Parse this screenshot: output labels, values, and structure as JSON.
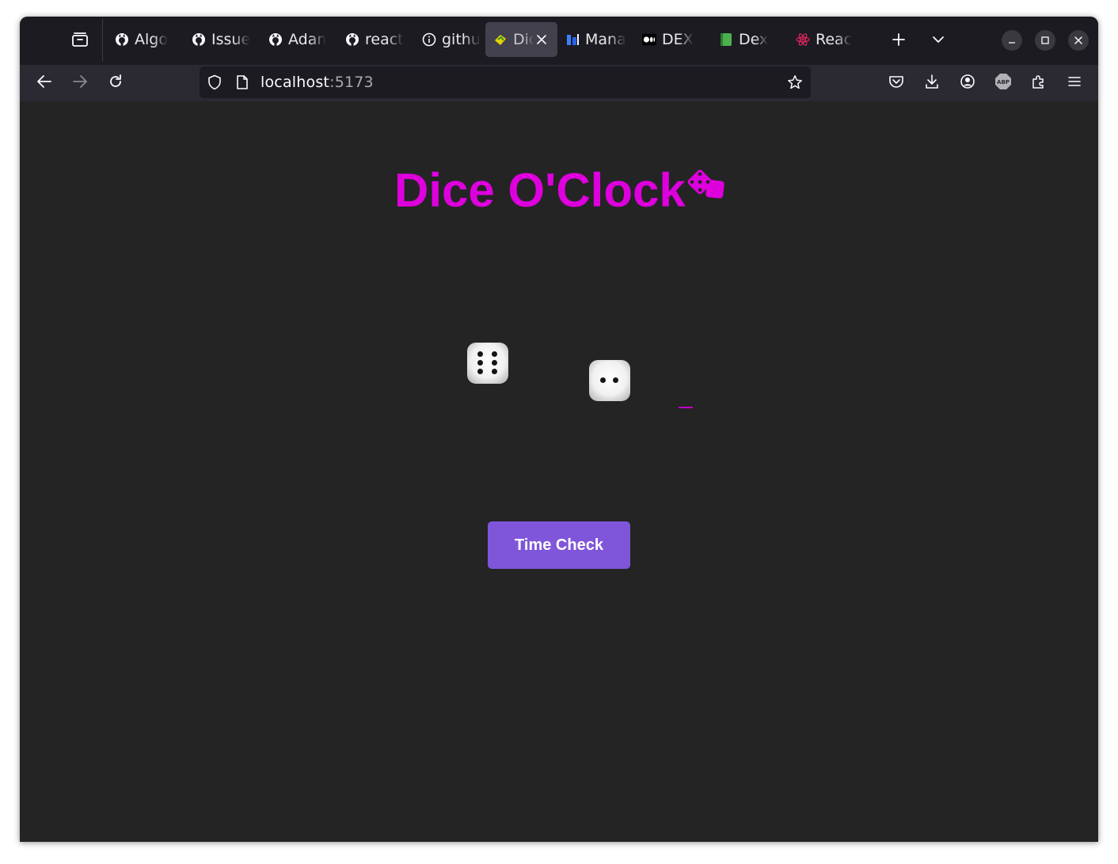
{
  "browser": {
    "tabs": [
      {
        "label": "Algo",
        "favicon": "github-icon",
        "active": false
      },
      {
        "label": "Issue",
        "favicon": "github-icon",
        "active": false
      },
      {
        "label": "Adan",
        "favicon": "github-icon",
        "active": false
      },
      {
        "label": "react",
        "favicon": "github-icon",
        "active": false
      },
      {
        "label": "githu",
        "favicon": "info-icon",
        "active": false
      },
      {
        "label": "Dic",
        "favicon": "dice-app-icon",
        "active": true
      },
      {
        "label": "Mana",
        "favicon": "manage-app-icon",
        "active": false
      },
      {
        "label": "DEX",
        "favicon": "medium-icon",
        "active": false
      },
      {
        "label": "Dex",
        "favicon": "book-icon",
        "active": false
      },
      {
        "label": "Reac",
        "favicon": "react-icon",
        "active": false
      }
    ],
    "url": {
      "host": "localhost",
      "port": ":5173"
    }
  },
  "page": {
    "title": "Dice O'Clock",
    "dice": [
      {
        "face": 6,
        "face_label": "six"
      },
      {
        "face": 2,
        "face_label": "two"
      }
    ],
    "time_check_label": "Time Check"
  },
  "colors": {
    "title": "#dd00dd",
    "button": "#7f56d9",
    "page_background": "#242424",
    "chrome_background": "#1c1b22"
  }
}
